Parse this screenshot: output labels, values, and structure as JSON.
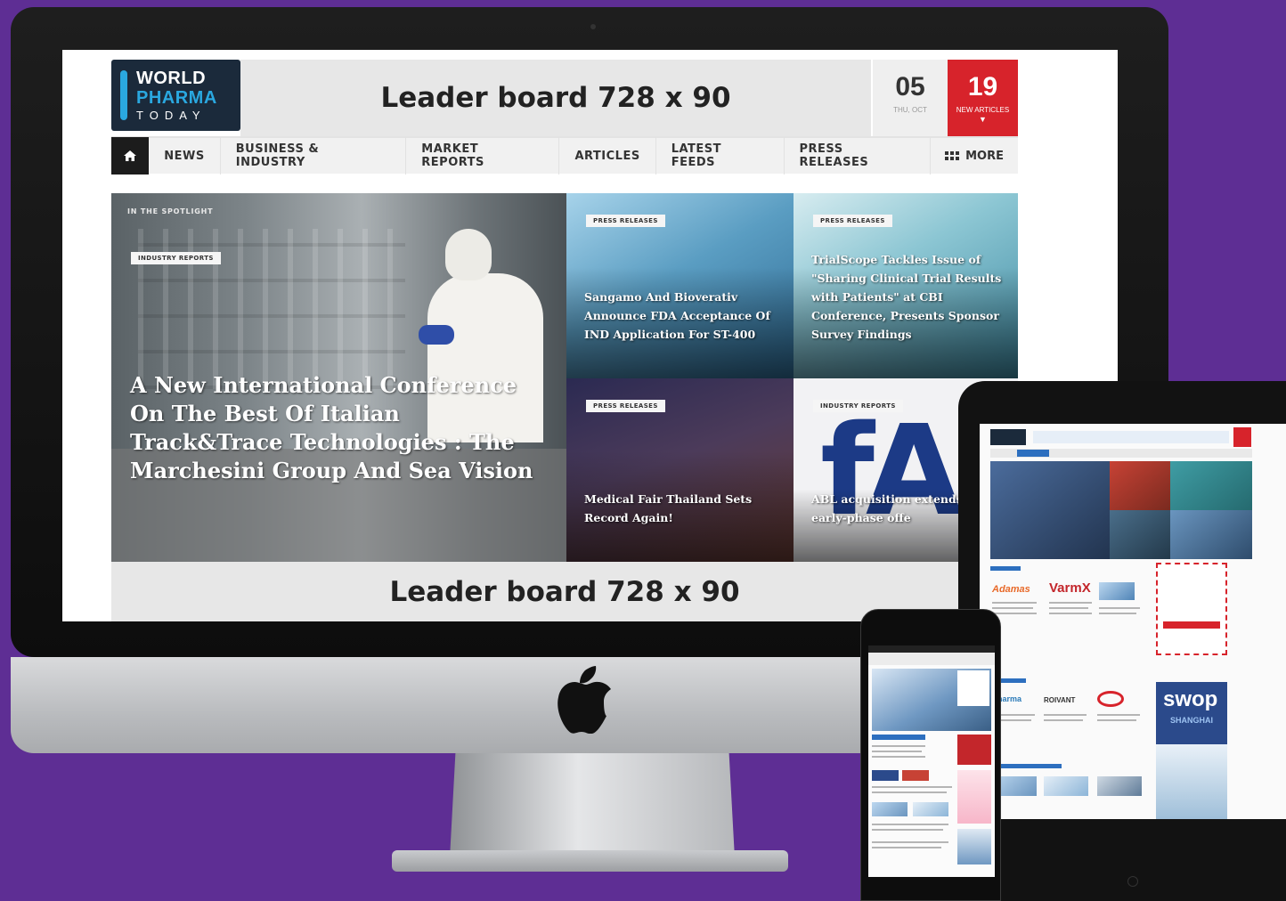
{
  "brand": {
    "logo_line1": "WORLD",
    "logo_line2": "PHARMA",
    "logo_line3": "TODAY",
    "accent": "#d7232b",
    "blue": "#2aa8e0",
    "background": "#5e2e94"
  },
  "header": {
    "leaderboard_top": "Leader board 728 x 90",
    "date_day": "05",
    "date_sub": "THU, OCT",
    "articles_count": "19",
    "articles_label": "NEW ARTICLES"
  },
  "nav": {
    "home_icon": "home-icon",
    "items": [
      "NEWS",
      "BUSINESS & INDUSTRY",
      "MARKET REPORTS",
      "ARTICLES",
      "LATEST FEEDS",
      "PRESS RELEASES"
    ],
    "more_label": "MORE"
  },
  "spotlight": {
    "section_label": "IN THE SPOTLIGHT",
    "main": {
      "tag": "INDUSTRY REPORTS",
      "title": "A New International Conference On The Best Of Italian Track&Trace Technologies : The Marchesini Group And Sea Vision"
    },
    "tiles": [
      {
        "tag": "PRESS RELEASES",
        "title": "Sangamo And Bioverativ Announce FDA Acceptance Of IND Application For ST-400"
      },
      {
        "tag": "PRESS RELEASES",
        "title": "TrialScope Tackles Issue of \"Sharing Clinical Trial Results with Patients\" at CBI Conference, Presents Sponsor Survey Findings"
      },
      {
        "tag": "PRESS RELEASES",
        "title": "Medical Fair Thailand Sets Record Again!"
      },
      {
        "tag": "INDUSTRY REPORTS",
        "title": "ABL acquisition extends Ardena's early-phase offe"
      }
    ]
  },
  "footer": {
    "leaderboard_bottom": "Leader board 728 x 90"
  },
  "tablet": {
    "brand_1": "Adamas",
    "brand_2": "VarmX",
    "brand_3": "ROIVANT",
    "ad_label": "swop",
    "ad_sub": "SHANGHAI"
  }
}
